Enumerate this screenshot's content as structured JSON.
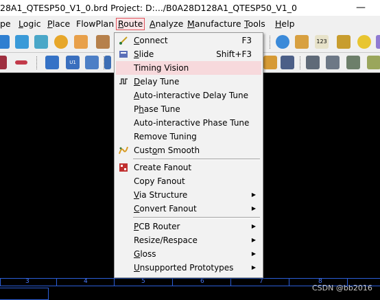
{
  "window": {
    "title": "28A1_QTESP50_V1_0.brd  Project: D:.../B0A28D128A1_QTESP50_V1_0",
    "minimize_glyph": "—"
  },
  "menubar": [
    {
      "label": "pe",
      "ul": ""
    },
    {
      "label": "Logic",
      "ul": "L"
    },
    {
      "label": "Place",
      "ul": "P"
    },
    {
      "label": "FlowPlan",
      "ul": ""
    },
    {
      "label": "Route",
      "ul": "R"
    },
    {
      "label": "Analyze",
      "ul": "A"
    },
    {
      "label": "Manufacture",
      "ul": "M"
    },
    {
      "label": "Tools",
      "ul": "T"
    },
    {
      "label": "Help",
      "ul": "H"
    }
  ],
  "route_menu": {
    "items": [
      {
        "pre": "",
        "ul": "C",
        "post": "onnect",
        "shortcut": "F3",
        "icon": "connect-icon",
        "submenu": false
      },
      {
        "pre": "",
        "ul": "S",
        "post": "lide",
        "shortcut": "Shift+F3",
        "icon": "slide-icon",
        "submenu": false
      },
      {
        "pre": "Timing Vision",
        "ul": "",
        "post": "",
        "shortcut": "",
        "icon": "",
        "submenu": false,
        "highlighted": true
      },
      {
        "pre": "",
        "ul": "D",
        "post": "elay Tune",
        "shortcut": "",
        "icon": "delay-tune-icon",
        "submenu": false
      },
      {
        "pre": "",
        "ul": "A",
        "post": "uto-interactive Delay Tune",
        "shortcut": "",
        "icon": "",
        "submenu": false
      },
      {
        "pre": "P",
        "ul": "h",
        "post": "ase Tune",
        "shortcut": "",
        "icon": "",
        "submenu": false
      },
      {
        "pre": "Auto-interactive Phase Tune",
        "ul": "",
        "post": "",
        "shortcut": "",
        "icon": "",
        "submenu": false
      },
      {
        "pre": "Remove Tuning",
        "ul": "",
        "post": "",
        "shortcut": "",
        "icon": "",
        "submenu": false
      },
      {
        "pre": "Cust",
        "ul": "o",
        "post": "m Smooth",
        "shortcut": "",
        "icon": "custom-smooth-icon",
        "submenu": false
      },
      {
        "pre": "Create Fanout",
        "ul": "",
        "post": "",
        "shortcut": "",
        "icon": "create-fanout-icon",
        "submenu": false
      },
      {
        "pre": "Copy Fanout",
        "ul": "",
        "post": "",
        "shortcut": "",
        "icon": "",
        "submenu": false
      },
      {
        "pre": "",
        "ul": "V",
        "post": "ia Structure",
        "shortcut": "",
        "icon": "",
        "submenu": true
      },
      {
        "pre": "",
        "ul": "C",
        "post": "onvert Fanout",
        "shortcut": "",
        "icon": "",
        "submenu": true
      },
      {
        "pre": "",
        "ul": "P",
        "post": "CB Router",
        "shortcut": "",
        "icon": "",
        "submenu": true
      },
      {
        "pre": "Resize/Respace",
        "ul": "",
        "post": "",
        "shortcut": "",
        "icon": "",
        "submenu": true
      },
      {
        "pre": "",
        "ul": "G",
        "post": "loss",
        "shortcut": "",
        "icon": "",
        "submenu": true
      },
      {
        "pre": "",
        "ul": "U",
        "post": "nsupported Prototypes",
        "shortcut": "",
        "icon": "",
        "submenu": true
      }
    ],
    "submenu_arrow": "▶"
  },
  "ruler": {
    "labels": [
      "3",
      "4",
      "5",
      "6",
      "7",
      "8"
    ]
  },
  "toolbar": {
    "badge_123": "123",
    "badge_u1": "U1"
  },
  "watermark": "CSDN @bb2016",
  "colors": {
    "menu_highlight": "#f7d9dc",
    "route_border": "#e0525b",
    "ruler": "#2c5fd9"
  }
}
